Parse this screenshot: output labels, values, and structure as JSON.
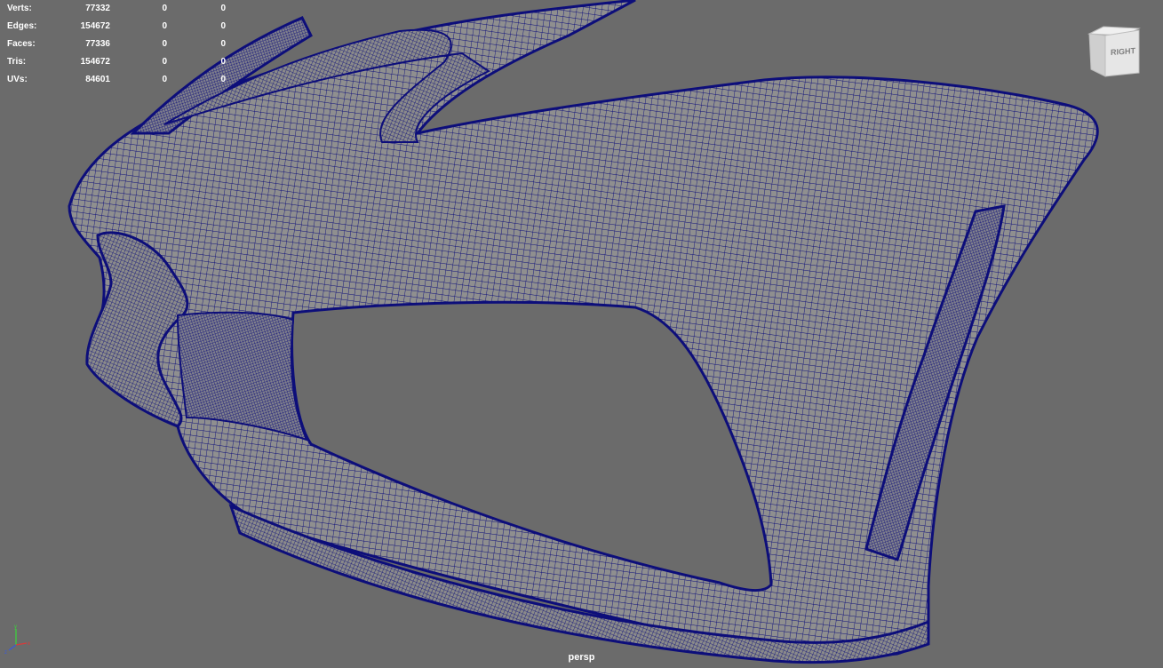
{
  "hud": {
    "rows": [
      {
        "label": "Verts:",
        "v1": "77332",
        "v2": "0",
        "v3": "0"
      },
      {
        "label": "Edges:",
        "v1": "154672",
        "v2": "0",
        "v3": "0"
      },
      {
        "label": "Faces:",
        "v1": "77336",
        "v2": "0",
        "v3": "0"
      },
      {
        "label": "Tris:",
        "v1": "154672",
        "v2": "0",
        "v3": "0"
      },
      {
        "label": "UVs:",
        "v1": "84601",
        "v2": "0",
        "v3": "0"
      }
    ]
  },
  "view_cube": {
    "face_label": "RIGHT"
  },
  "camera": {
    "name": "persp"
  },
  "colors": {
    "viewport_bg": "#6b6b6b",
    "mesh_surface": "#8f8f8f",
    "wireframe": "#0d0e7a",
    "hud_text": "#ffffff",
    "axis_x": "#d83a3a",
    "axis_y": "#3ad83a",
    "axis_z": "#3a5ad8"
  },
  "icons": {
    "axis_gizmo": "axis-gizmo-icon",
    "view_cube": "view-cube-icon"
  }
}
